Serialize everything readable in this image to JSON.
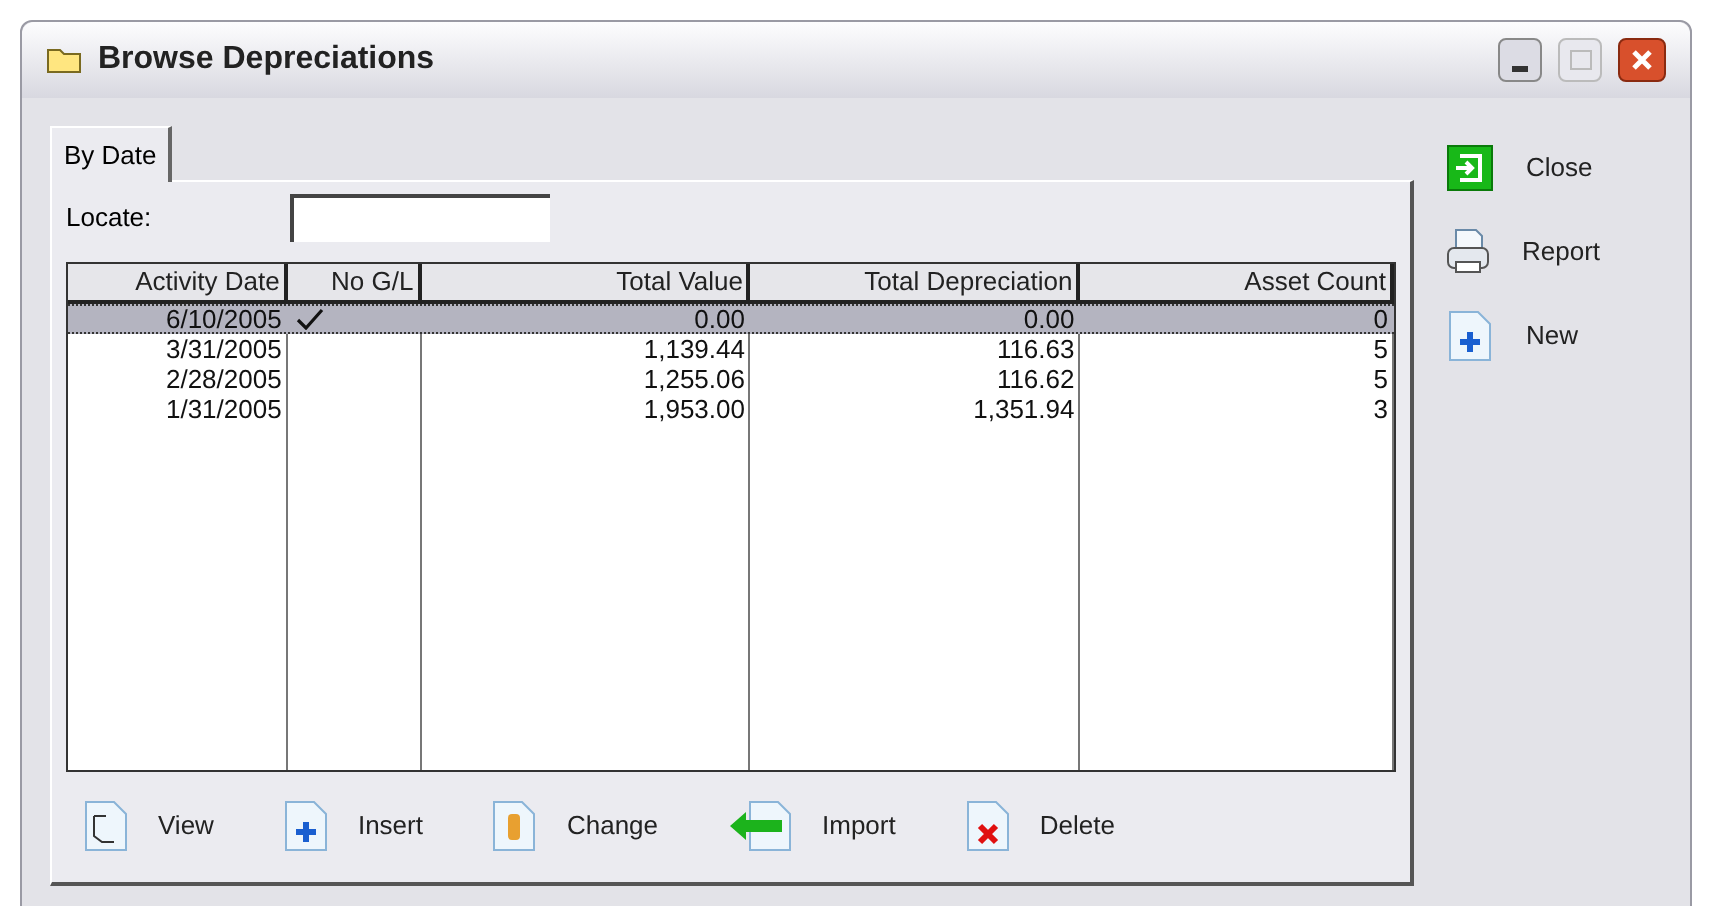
{
  "window": {
    "title": "Browse Depreciations"
  },
  "tabs": [
    {
      "label": "By Date",
      "selected": true
    }
  ],
  "locate": {
    "label": "Locate:"
  },
  "table": {
    "columns": [
      "Activity Date",
      "No G/L",
      "Total Value",
      "Total Depreciation",
      "Asset Count"
    ],
    "rows": [
      {
        "cells": [
          "6/10/2005",
          "",
          "0.00",
          "0.00",
          "0"
        ],
        "no_gl": true,
        "selected": true
      },
      {
        "cells": [
          "3/31/2005",
          "",
          "1,139.44",
          "116.63",
          "5"
        ],
        "no_gl": false,
        "selected": false
      },
      {
        "cells": [
          "2/28/2005",
          "",
          "1,255.06",
          "116.62",
          "5"
        ],
        "no_gl": false,
        "selected": false
      },
      {
        "cells": [
          "1/31/2005",
          "",
          "1,953.00",
          "1,351.94",
          "3"
        ],
        "no_gl": false,
        "selected": false
      }
    ]
  },
  "bottom_buttons": [
    {
      "label": "View",
      "kind": "view"
    },
    {
      "label": "Insert",
      "kind": "insert"
    },
    {
      "label": "Change",
      "kind": "change"
    },
    {
      "label": "Import",
      "kind": "import"
    },
    {
      "label": "Delete",
      "kind": "delete"
    }
  ],
  "side_buttons": [
    {
      "label": "Close",
      "kind": "close"
    },
    {
      "label": "Report",
      "kind": "report"
    },
    {
      "label": "New",
      "kind": "new"
    }
  ]
}
